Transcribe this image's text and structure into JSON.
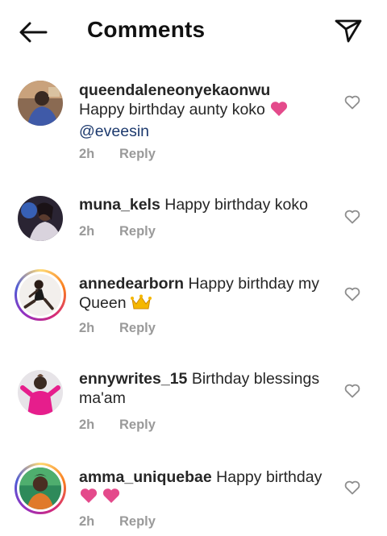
{
  "header": {
    "title": "Comments"
  },
  "colors": {
    "heart_emoji": "#e44a8b",
    "meta_gray": "#9a9a9a",
    "mention_blue": "#1d3a6e"
  },
  "comments": [
    {
      "username": "queendaleneonyekaonwu",
      "text": "Happy birthday aunty koko",
      "emoji": "pink-heart",
      "mention": "@eveesin",
      "time": "2h",
      "reply_label": "Reply",
      "story_ring": false
    },
    {
      "username": "muna_kels",
      "text": "Happy birthday koko",
      "time": "2h",
      "reply_label": "Reply",
      "story_ring": false
    },
    {
      "username": "annedearborn",
      "text": "Happy birthday my Queen",
      "emoji": "crown",
      "time": "2h",
      "reply_label": "Reply",
      "story_ring": true
    },
    {
      "username": "ennywrites_15",
      "text": "Birthday blessings ma'am",
      "time": "2h",
      "reply_label": "Reply",
      "story_ring": false
    },
    {
      "username": "amma_uniquebae",
      "text": "Happy birthday",
      "emoji": "two-pink-hearts",
      "time": "2h",
      "reply_label": "Reply",
      "story_ring": true
    }
  ]
}
